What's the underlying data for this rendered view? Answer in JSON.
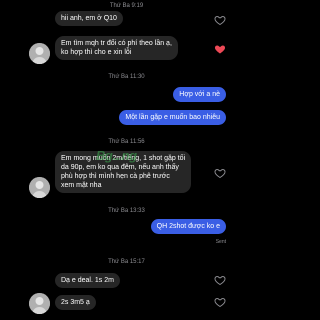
{
  "chat": {
    "timestamps": [
      "Thứ Ba 9:19",
      "Thứ Ba 11:30",
      "Thứ Ba 11:56",
      "Thứ Ba 13:33",
      "Thứ Ba 15:17"
    ],
    "messages": [
      {
        "sender": "them",
        "lines": [
          "hii anh, em ở Q10"
        ],
        "liked": false
      },
      {
        "sender": "them",
        "lines": [
          "Em tìm mqh tr đổi có phí theo lần ạ,",
          "ko hợp thì cho e xin lỗi"
        ],
        "liked": true
      },
      {
        "sender": "me",
        "lines": [
          "Hợp với a nè"
        ]
      },
      {
        "sender": "me",
        "lines": [
          "Một lần gặp e muốn bao nhiêu"
        ]
      },
      {
        "sender": "them",
        "lines": [
          "Em mong muốn 2m/tiếng, 1 shot gặp tối",
          "da 90p, em ko qua đêm, nếu anh thấy",
          "phù hợp thì mình hẹn cà phê trước",
          "xem mặt nha"
        ],
        "liked": false
      },
      {
        "sender": "me",
        "lines": [
          "QH 2shot được ko e"
        ]
      },
      {
        "sender": "them",
        "lines": [
          "Dạ e deal. 1s 2m"
        ],
        "liked": false
      },
      {
        "sender": "them",
        "lines": [
          "2s 3m5 ạ"
        ],
        "liked": false
      }
    ],
    "sent_label": "Sent",
    "watermark": "Bg...ng"
  },
  "colors": {
    "background": "#000000",
    "incoming_bubble": "#262626",
    "outgoing_bubble": "#3a5ee5",
    "timestamp": "#8e8e93",
    "liked_heart": "#ed4956"
  },
  "icons": [
    "heart-outline-icon",
    "heart-filled-icon",
    "avatar-photo"
  ]
}
